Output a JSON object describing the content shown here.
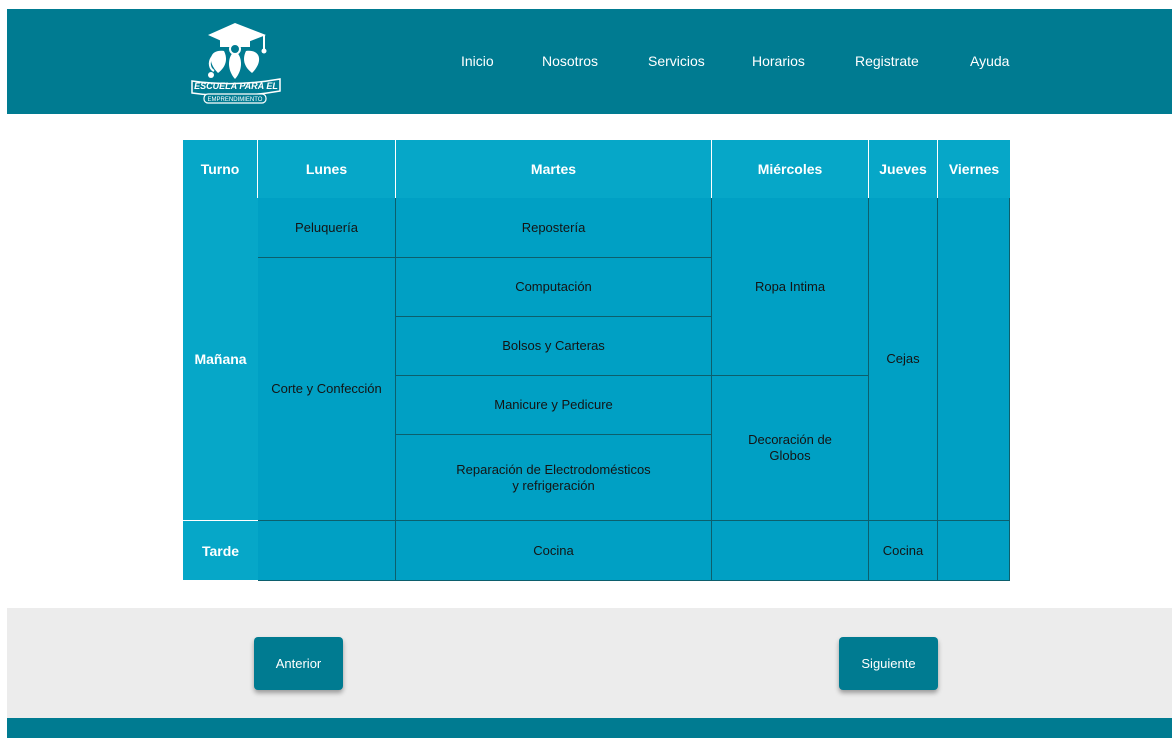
{
  "header": {
    "logo_text_line1": "ESCUELA PARA EL",
    "logo_text_line2": "EMPRENDIMIENTO",
    "nav": [
      {
        "label": "Inicio"
      },
      {
        "label": "Nosotros"
      },
      {
        "label": "Servicios"
      },
      {
        "label": "Horarios"
      },
      {
        "label": "Registrate"
      },
      {
        "label": "Ayuda"
      }
    ]
  },
  "schedule": {
    "headers": [
      "Turno",
      "Lunes",
      "Martes",
      "Miércoles",
      "Jueves",
      "Viernes"
    ],
    "rows": {
      "morning_label": "Mañana",
      "afternoon_label": "Tarde"
    },
    "cells": {
      "mon_peluqueria": "Peluquería",
      "mon_corte": "Corte y Confección",
      "tue_reposteria": "Repostería",
      "tue_computacion": "Computación",
      "tue_bolsos": "Bolsos y Carteras",
      "tue_manicure": "Manicure y Pedicure",
      "tue_reparacion": "Reparación de Electrodomésticos y refrigeración",
      "wed_ropa": "Ropa Intima",
      "wed_decoracion": "Decoración de Globos",
      "thu_cejas": "Cejas",
      "tue_cocina_tarde": "Cocina",
      "thu_cocina_tarde": "Cocina"
    }
  },
  "buttons": {
    "prev": "Anterior",
    "next": "Siguiente"
  },
  "colors": {
    "header": "#007b91",
    "table_cell": "#00a0c4",
    "table_header": "#06a7c8",
    "gray_band": "#ececec"
  }
}
